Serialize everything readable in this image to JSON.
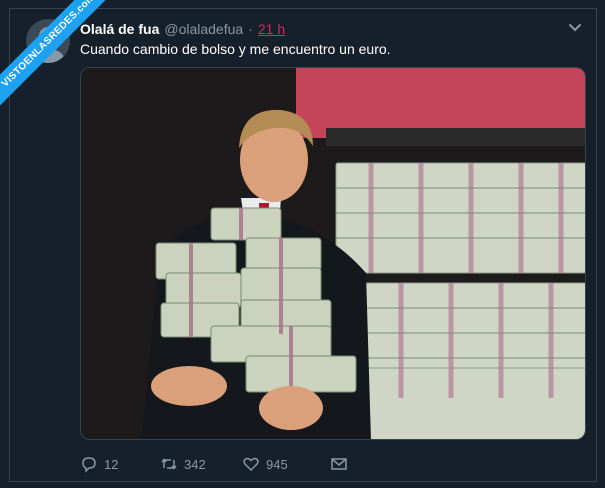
{
  "tweet": {
    "author_name": "Olalá de fua",
    "handle": "@olaladefua",
    "separator": "·",
    "time": "21 h",
    "text": "Cuando cambio de bolso y me encuentro un euro."
  },
  "watermark": {
    "text": "VISTOENLASREDES.com"
  },
  "actions": {
    "replies": "12",
    "retweets": "342",
    "likes": "945"
  },
  "colors": {
    "background": "#15202b",
    "accent": "#1da1f2",
    "time_red": "#e0245e",
    "muted": "#8899a6"
  },
  "icons": [
    "chevron-down-icon",
    "reply-icon",
    "retweet-icon",
    "like-icon",
    "message-icon"
  ]
}
